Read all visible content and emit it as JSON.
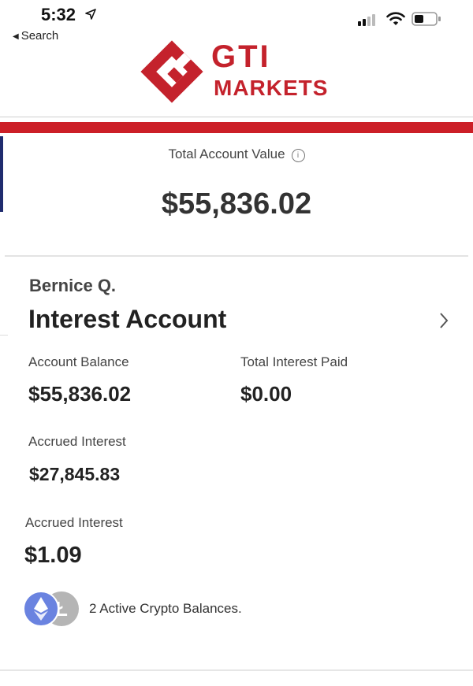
{
  "status_bar": {
    "time": "5:32",
    "back_label": "Search"
  },
  "brand": {
    "name_line1": "GTI",
    "name_line2": "MARKETS",
    "color": "#c4222c"
  },
  "summary": {
    "total_label": "Total Account Value",
    "total_value": "$55,836.02"
  },
  "account": {
    "owner": "Bernice Q.",
    "title": "Interest Account",
    "balance_label": "Account Balance",
    "balance_value": "$55,836.02",
    "interest_paid_label": "Total Interest Paid",
    "interest_paid_value": "$0.00",
    "accrued_label_1": "Accrued Interest",
    "accrued_value_1": "$27,845.83",
    "accrued_label_2": "Accrued Interest",
    "accrued_value_2": "$1.09",
    "crypto_text": "2 Active Crypto Balances."
  },
  "icons": [
    "location-arrow-icon",
    "signal-icon",
    "wifi-icon",
    "battery-icon",
    "info-icon",
    "chevron-right-icon",
    "ethereum-icon",
    "litecoin-icon"
  ],
  "colors": {
    "accent_red": "#cc1f27",
    "navy": "#1f2b6e",
    "ethereum_blue": "#6a83e0",
    "litecoin_gray": "#b5b5b5"
  }
}
